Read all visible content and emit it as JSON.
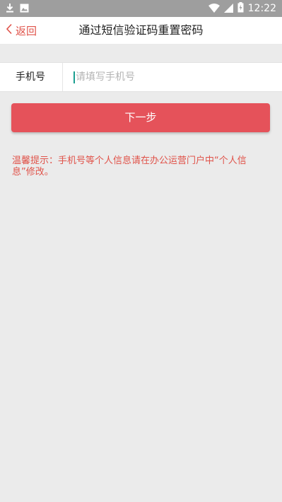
{
  "status_bar": {
    "time": "12:22",
    "left_icons": [
      "download-icon",
      "image-icon"
    ],
    "right_icons": [
      "wifi-icon",
      "signal-icon",
      "battery-icon"
    ]
  },
  "nav": {
    "back_label": "返回",
    "title": "通过短信验证码重置密码"
  },
  "form": {
    "phone_label": "手机号",
    "phone_placeholder": "请填写手机号",
    "phone_value": ""
  },
  "next_button_label": "下一步",
  "tip_text": "温馨提示：手机号等个人信息请在办公运营门户中“个人信息”修改。",
  "colors": {
    "accent": "#e5525a",
    "status_bar": "#9e9e9e",
    "background": "#ebebeb"
  }
}
